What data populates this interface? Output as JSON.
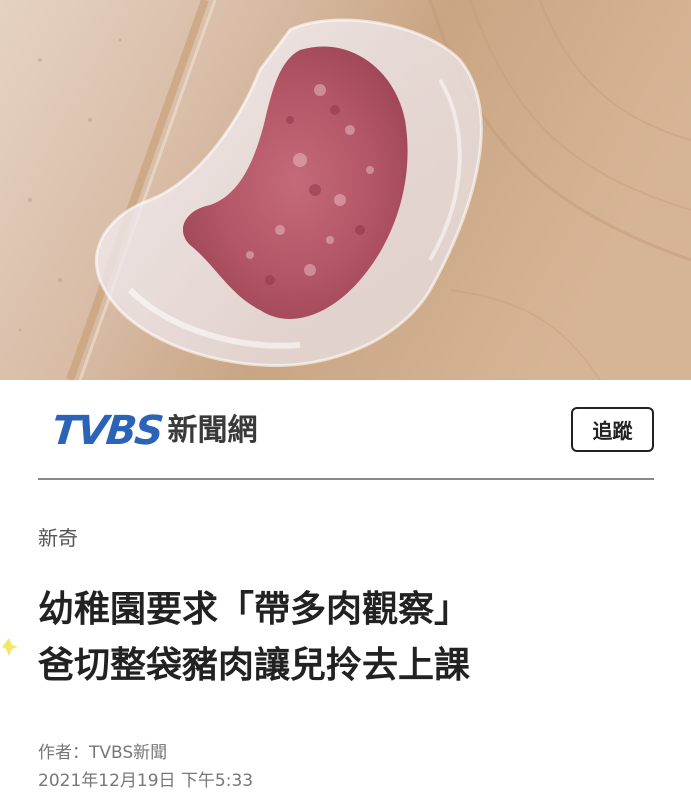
{
  "hero": {
    "description_icon": "photo-meat-in-plastic-bag"
  },
  "header": {
    "logo_text": "TVBS",
    "logo_suffix": "新聞網",
    "follow_label": "追蹤",
    "brand_color": "#2a63b8"
  },
  "article": {
    "category": "新奇",
    "headline_line1": "幼稚園要求「帶多肉觀察」",
    "headline_line2": "爸切整袋豬肉讓兒拎去上課",
    "author": "作者：TVBS新聞",
    "date": "2021年12月19日 下午5:33"
  }
}
